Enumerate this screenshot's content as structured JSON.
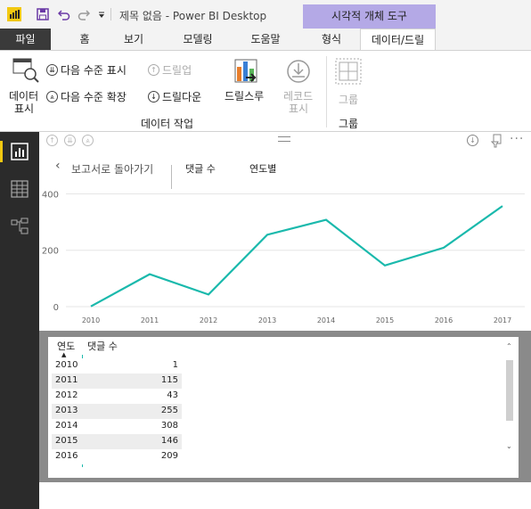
{
  "titlebar": {
    "title": "제목 없음 - Power BI Desktop",
    "context_header": "시각적 개체 도구",
    "logo_color": "#f2c811"
  },
  "tabs": [
    {
      "label": "파일"
    },
    {
      "label": "홈"
    },
    {
      "label": "보기"
    },
    {
      "label": "모델링"
    },
    {
      "label": "도움말"
    },
    {
      "label": "형식"
    },
    {
      "label": "데이터/드릴"
    }
  ],
  "ribbon": {
    "data_view_label_1": "데이터",
    "data_view_label_2": "표시",
    "next_level": "다음 수준 표시",
    "expand_next_level": "다음 수준 확장",
    "drill_up": "드릴업",
    "drill_down": "드릴다운",
    "drill_through": "드릴스루",
    "record_1": "레코드",
    "record_2": "표시",
    "group_btn": "그룹",
    "group_data_actions": "데이터 작업",
    "group_group": "그룹"
  },
  "visual": {
    "back_label": "보고서로 돌아가기",
    "field_label": "댓글 수",
    "by_label": "연도별"
  },
  "chart_data": {
    "type": "line",
    "x": [
      "2010",
      "2011",
      "2012",
      "2013",
      "2014",
      "2015",
      "2016",
      "2017"
    ],
    "series": [
      {
        "values": [
          1,
          115,
          43,
          255,
          308,
          146,
          209,
          357
        ],
        "color": "#1ab9ac"
      }
    ],
    "yticks": [
      "0",
      "200",
      "400"
    ],
    "ylim": [
      0,
      430
    ],
    "grid": true
  },
  "table": {
    "col_year": "연도",
    "col_comments": "댓글 수",
    "rows": [
      {
        "year": "2010",
        "value": "1"
      },
      {
        "year": "2011",
        "value": "115"
      },
      {
        "year": "2012",
        "value": "43"
      },
      {
        "year": "2013",
        "value": "255"
      },
      {
        "year": "2014",
        "value": "308"
      },
      {
        "year": "2015",
        "value": "146"
      },
      {
        "year": "2016",
        "value": "209"
      }
    ]
  }
}
